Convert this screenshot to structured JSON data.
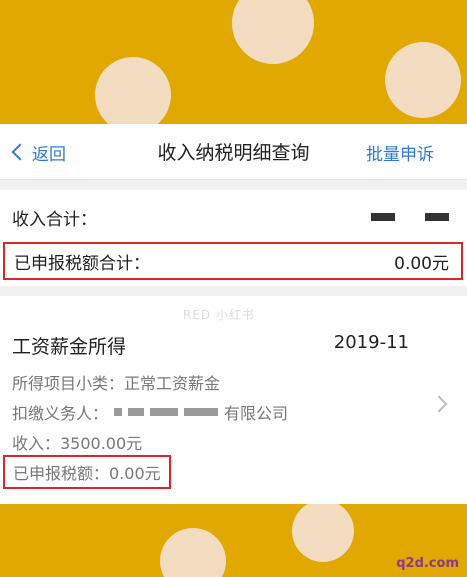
{
  "nav": {
    "back_label": "返回",
    "title": "收入纳税明细查询",
    "batch_label": "批量申诉"
  },
  "summary": {
    "income_total_label": "收入合计：",
    "tax_total_label": "已申报税额合计：",
    "tax_total_value": "0.00元"
  },
  "income_item": {
    "watermark": "RED 小红书",
    "title": "工资薪金所得",
    "period": "2019-11",
    "sub_category": "所得项目小类：正常工资薪金",
    "withholder_prefix": "扣缴义务人：",
    "withholder_suffix": "有限公司",
    "income": "收入：3500.00元",
    "tax_declared": "已申报税额：0.00元"
  },
  "footer": {
    "logo_text": "q2d.com"
  },
  "colors": {
    "background": "#E0A800",
    "accent_blue": "#2E7BD6",
    "highlight_red": "#D9272E"
  }
}
